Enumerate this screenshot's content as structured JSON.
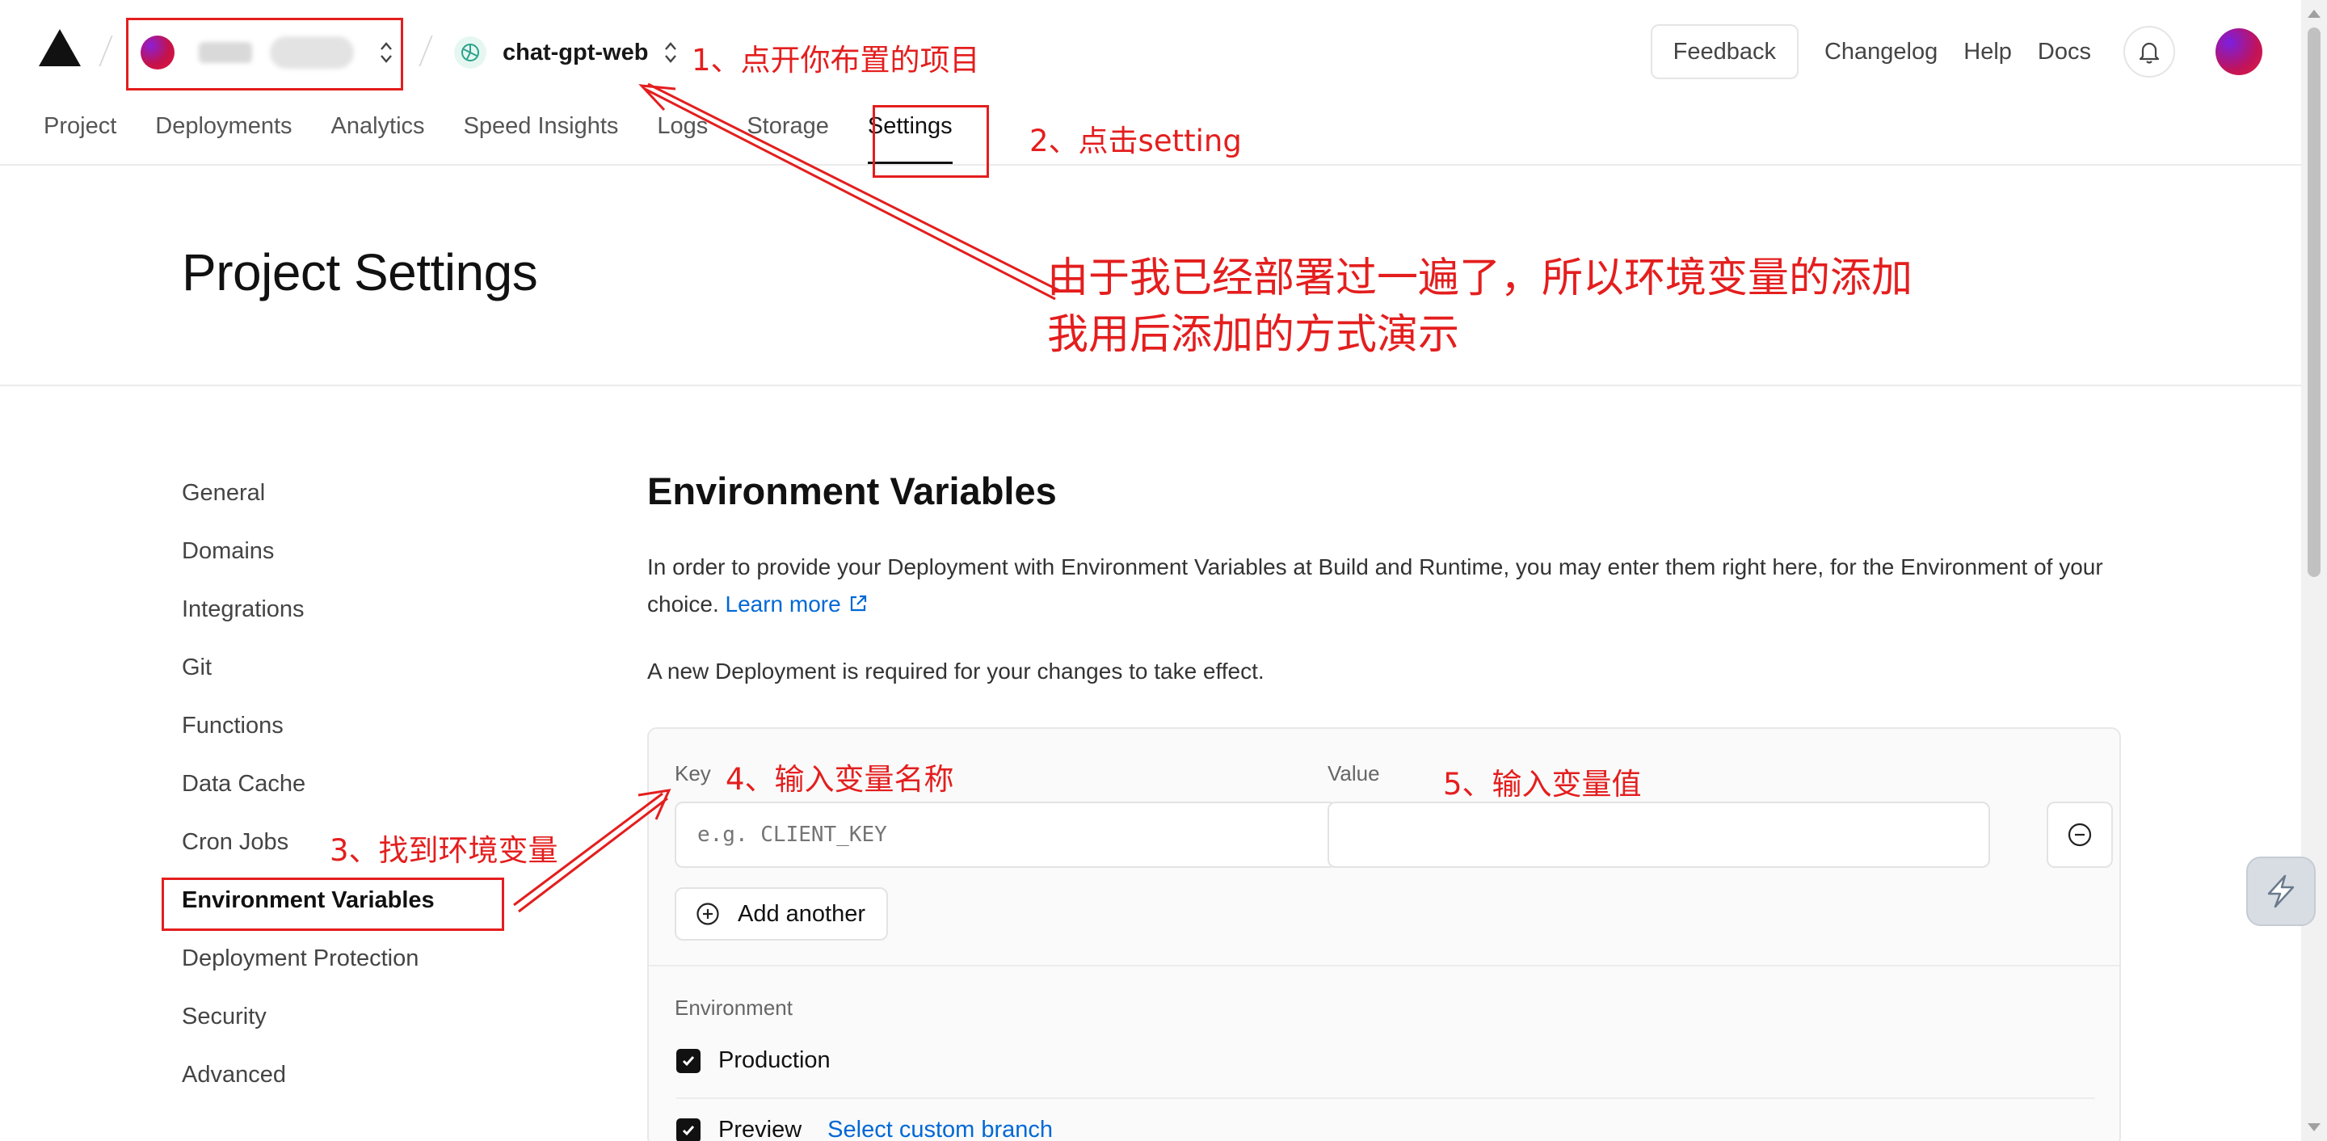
{
  "header": {
    "team_switcher_chevron": "⌃⌄",
    "project_name": "chat-gpt-web",
    "feedback_label": "Feedback",
    "links": [
      "Changelog",
      "Help",
      "Docs"
    ]
  },
  "tabs": [
    {
      "label": "Project",
      "active": false
    },
    {
      "label": "Deployments",
      "active": false
    },
    {
      "label": "Analytics",
      "active": false
    },
    {
      "label": "Speed Insights",
      "active": false
    },
    {
      "label": "Logs",
      "active": false
    },
    {
      "label": "Storage",
      "active": false
    },
    {
      "label": "Settings",
      "active": true
    }
  ],
  "page_title": "Project Settings",
  "sidebar": {
    "items": [
      {
        "label": "General"
      },
      {
        "label": "Domains"
      },
      {
        "label": "Integrations"
      },
      {
        "label": "Git"
      },
      {
        "label": "Functions"
      },
      {
        "label": "Data Cache"
      },
      {
        "label": "Cron Jobs"
      },
      {
        "label": "Environment Variables",
        "active": true
      },
      {
        "label": "Deployment Protection"
      },
      {
        "label": "Security"
      },
      {
        "label": "Advanced"
      }
    ]
  },
  "env_section": {
    "title": "Environment Variables",
    "description": "In order to provide your Deployment with Environment Variables at Build and Runtime, you may enter them right here, for the Environment of your choice.",
    "learn_more": "Learn more",
    "note": "A new Deployment is required for your changes to take effect.",
    "key_label": "Key",
    "key_placeholder": "e.g. CLIENT_KEY",
    "key_value": "",
    "value_label": "Value",
    "value_value": "",
    "add_another": "Add another",
    "environment_label": "Environment",
    "environments": [
      {
        "label": "Production",
        "checked": true
      },
      {
        "label": "Preview",
        "checked": true,
        "extra_link": "Select custom branch"
      }
    ]
  },
  "annotations": {
    "step1": "1、点开你布置的项目",
    "step2": "2、点击setting",
    "step3": "3、找到环境变量",
    "step4": "4、输入变量名称",
    "step5": "5、输入变量值",
    "note_line1": "由于我已经部署过一遍了，所以环境变量的添加",
    "note_line2": "我用后添加的方式演示",
    "color": "#e41e1e"
  },
  "colors": {
    "accent_link": "#0068d6",
    "text_primary": "#111111",
    "text_secondary": "#444444",
    "annotation_red": "#e41e1e"
  },
  "icons": {
    "logo": "triangle-logo-icon",
    "project": "openai-icon",
    "bell": "bell-icon",
    "external": "external-link-icon",
    "remove": "minus-circle-icon",
    "add": "plus-circle-icon",
    "check": "checkmark-icon",
    "float": "floating-assistant-icon"
  }
}
